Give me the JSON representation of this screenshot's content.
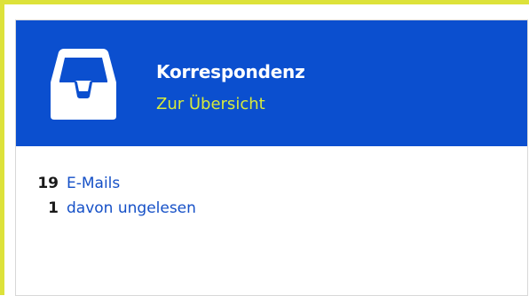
{
  "colors": {
    "accent": "#dde23a",
    "header_bg": "#0b4fcf",
    "link_green": "#d7ea3b",
    "link_blue": "#1550c7"
  },
  "card": {
    "icon": "inbox-tray-icon",
    "title": "Korrespondenz",
    "overview_link": "Zur Übersicht"
  },
  "stats": [
    {
      "count": "19",
      "label": "E-Mails"
    },
    {
      "count": "1",
      "label": "davon ungelesen"
    }
  ]
}
